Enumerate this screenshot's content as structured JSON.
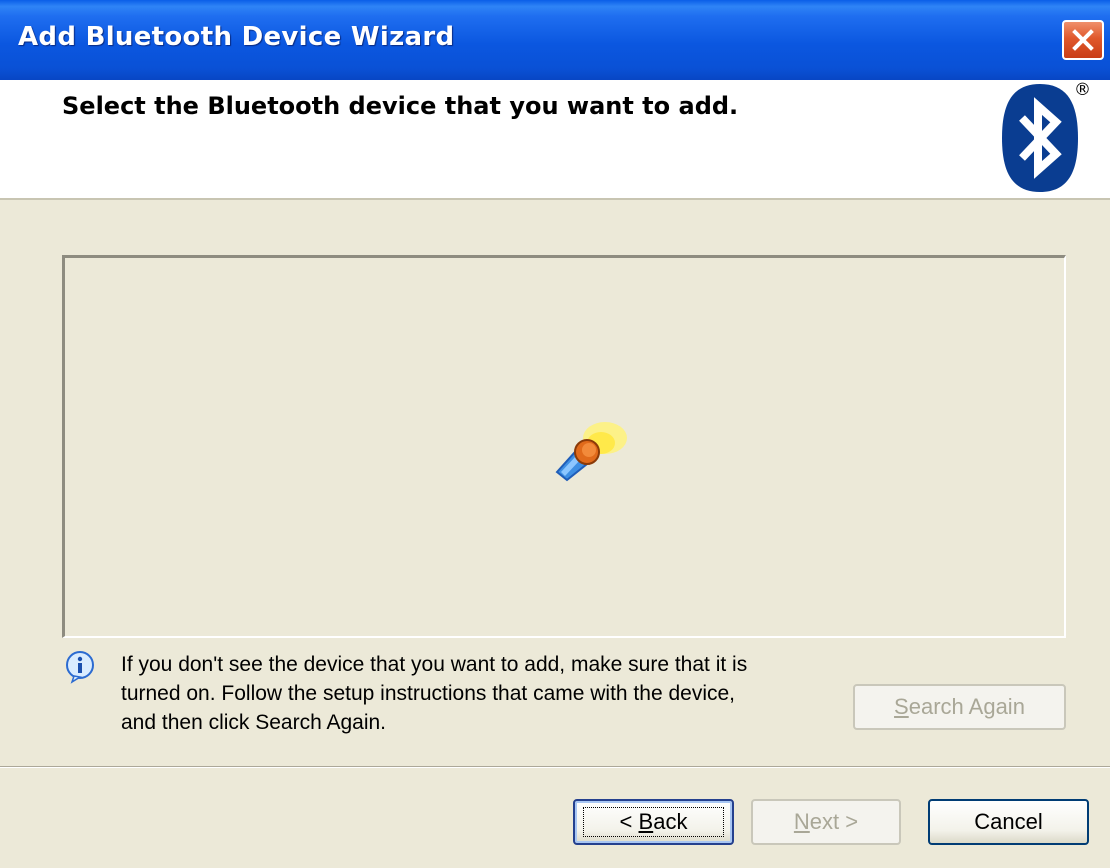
{
  "window": {
    "title": "Add Bluetooth Device Wizard"
  },
  "header": {
    "title": "Select the Bluetooth device that you want to add.",
    "logo_mark": "®",
    "logo_icon": "bluetooth-logo-icon"
  },
  "device_list": {
    "status_icon": "searching-flashlight-icon",
    "items": []
  },
  "info": {
    "icon": "info-icon",
    "lines": [
      "If you don't see the device that you want to add, make sure that it is",
      "turned on. Follow the setup instructions that came with the device,",
      "and then click Search Again."
    ]
  },
  "buttons": {
    "search_again": {
      "mnemonic": "S",
      "rest": "earch Again",
      "enabled": false
    },
    "back": {
      "prefix": "< ",
      "mnemonic": "B",
      "rest": "ack",
      "enabled": true
    },
    "next": {
      "mnemonic": "N",
      "rest": "ext >",
      "enabled": false
    },
    "cancel": {
      "label": "Cancel",
      "enabled": true
    }
  },
  "colors": {
    "titlebar": "#0a51d6",
    "dialog_bg": "#ece9d8",
    "bluetooth_blue": "#0a3d91",
    "close_red": "#e0582c",
    "disabled_text": "#a9a797"
  }
}
